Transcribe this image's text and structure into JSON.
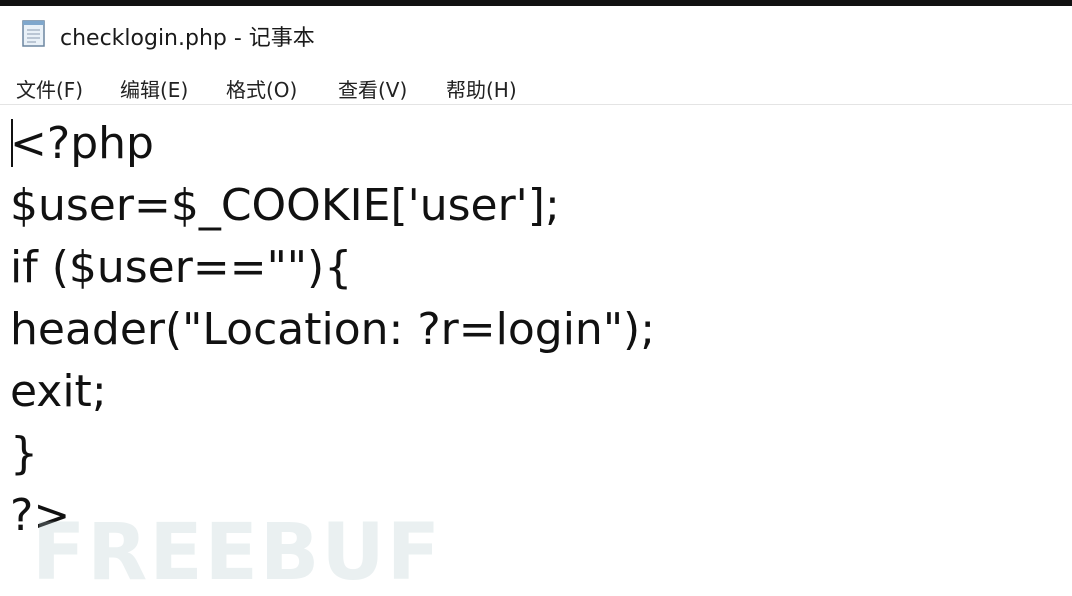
{
  "window": {
    "title": "checklogin.php - 记事本",
    "icon": "notepad-icon"
  },
  "menu": {
    "items": [
      {
        "label": "文件(F)"
      },
      {
        "label": "编辑(E)"
      },
      {
        "label": "格式(O)"
      },
      {
        "label": "查看(V)"
      },
      {
        "label": "帮助(H)"
      }
    ]
  },
  "editor": {
    "lines": [
      "<?php",
      "$user=$_COOKIE['user'];",
      "if ($user==\"\"){",
      "header(\"Location: ?r=login\");",
      "exit;",
      "}",
      "?>"
    ]
  },
  "watermark": {
    "text": "FREEBUF"
  }
}
